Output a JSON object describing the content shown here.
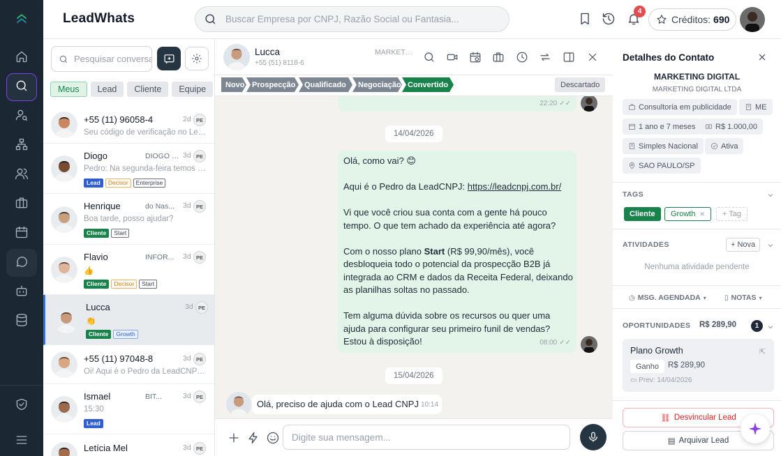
{
  "app": {
    "title": "LeadWhats"
  },
  "search": {
    "placeholder": "Buscar Empresa por CNPJ, Razão Social ou Fantasia..."
  },
  "header": {
    "notifications_count": "4",
    "credits_label": "Créditos:",
    "credits_value": "690"
  },
  "icons": {
    "nav": [
      "home-icon",
      "search-icon",
      "user-search-icon",
      "org-chart-icon",
      "users-icon",
      "briefcase-icon",
      "calendar-icon",
      "chat-icon",
      "bot-icon",
      "database-icon"
    ],
    "nav_bottom": [
      "shield-check-icon",
      "menu-icon"
    ]
  },
  "colors": {
    "nav_bg": "#1b2733",
    "accent_green": "#17834b",
    "accent_blue": "#2f5fd0",
    "active_ring": "#7b3fe4"
  },
  "chatlist": {
    "search_placeholder": "Pesquisar conversas",
    "filters": [
      "Meus",
      "Lead",
      "Cliente",
      "Equipe"
    ],
    "items": [
      {
        "name": "+55 (11) 96058-4",
        "tag": "",
        "date": "2d",
        "badge": "PE",
        "preview": "Seu código de verificação no Lea...",
        "chips": []
      },
      {
        "name": "Diogo",
        "tag": "DIOGO DE...",
        "date": "3d",
        "badge": "PE",
        "preview": "Pedro: Na segunda-feira temos d...",
        "chips": [
          "Lead",
          "Decisor",
          "Enterprise"
        ]
      },
      {
        "name": "Henrique",
        "tag": "do Nas...",
        "date": "3d",
        "badge": "PE",
        "preview": "Boa tarde, posso ajudar?",
        "chips": [
          "Cliente",
          "Start"
        ]
      },
      {
        "name": "Flavio",
        "tag": "INFOR...",
        "date": "3d",
        "badge": "PE",
        "preview": "👍",
        "chips": [
          "Cliente",
          "Decisor",
          "Start"
        ]
      },
      {
        "name": "Lucca",
        "tag": "",
        "date": "3d",
        "badge": "PE",
        "preview": "👏",
        "chips": [
          "Cliente",
          "Growth"
        ]
      },
      {
        "name": "+55 (11) 97048-8",
        "tag": "",
        "date": "3d",
        "badge": "PE",
        "preview": "Oi! Aqui é o Pedro da LeadCNPJ ...",
        "chips": []
      },
      {
        "name": "Ismael",
        "tag": "BIT...",
        "date": "3d",
        "badge": "PE",
        "preview": "15:30",
        "chips": [
          "Lead"
        ]
      },
      {
        "name": "Letícia Mel",
        "tag": "",
        "date": "3d",
        "badge": "PE",
        "preview": "",
        "chips": []
      }
    ]
  },
  "conversation": {
    "contact_name": "Lucca",
    "contact_phone": "+55 (51) 8118-6",
    "segment": "MARKETI...",
    "stages": [
      "Novo",
      "Prospecção",
      "Qualificado",
      "Negociação",
      "Convertido"
    ],
    "discard_label": "Descartado",
    "messages": {
      "prev_time": "22:20",
      "date1": "14/04/2026",
      "m1_greeting": "Olá, como vai? 😊",
      "m1_intro": "Aqui é o Pedro da LeadCNPJ: ",
      "m1_link": "https://leadcnpj.com.br/",
      "m1_p2": "Vi que você criou sua conta com a gente há pouco tempo. O que tem achado da experiência até agora?",
      "m1_p3_a": "Com o nosso plano ",
      "m1_p3_plan": "Start",
      "m1_p3_b": " (R$ 99,90/mês), você desbloqueia todo o potencial da prospecção B2B já integrada ao CRM e dados da Receita Federal, deixando as planilhas soltas no passado.",
      "m1_p4": "Tem alguma dúvida sobre os recursos ou quer uma ajuda para configurar seu primeiro funil de vendas? Estou à disposição!",
      "m1_time": "08:00",
      "date2": "15/04/2026",
      "m2_text": "Olá, preciso de ajuda com o Lead CNPJ",
      "m2_time": "10:14"
    },
    "composer_placeholder": "Digite sua mensagem..."
  },
  "details": {
    "title": "Detalhes do Contato",
    "company_name": "MARKETING DIGITAL",
    "company_legal": "MARKETING DIGITAL LTDA",
    "pills": [
      "Consultoria em publicidade",
      "ME",
      "1 ano e 7 meses",
      "R$ 1.000,00",
      "Simples Nacional",
      "Ativa",
      "SAO PAULO/SP"
    ],
    "tags_label": "TAGS",
    "tags": [
      "Cliente",
      "Growth"
    ],
    "add_tag": "+ Tag",
    "activities_label": "ATIVIDADES",
    "new_label": "+ Nova",
    "no_activity": "Nenhuma atividade pendente",
    "scheduled_label": "MSG. AGENDADA",
    "notes_label": "NOTAS",
    "opportunities_label": "OPORTUNIDADES",
    "opportunities_total": "R$ 289,90",
    "opportunities_count": "1",
    "opp": {
      "name": "Plano Growth",
      "status": "Ganho",
      "value": "R$ 289,90",
      "forecast": "Prev: 14/04/2026"
    },
    "unlink_label": "Desvincular Lead",
    "archive_label": "Arquivar Lead"
  }
}
